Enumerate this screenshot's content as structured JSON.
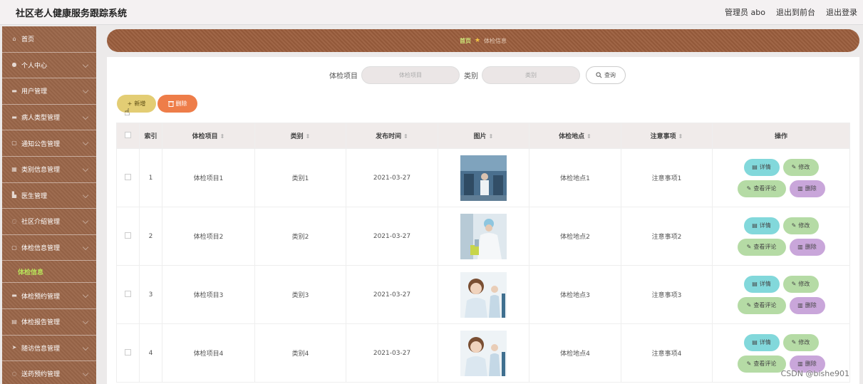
{
  "header": {
    "title": "社区老人健康服务跟踪系统",
    "admin": "管理员 abo",
    "to_front": "退出到前台",
    "logout": "退出登录"
  },
  "sidebar": {
    "items": [
      {
        "label": "首页",
        "icon": "home-icon"
      },
      {
        "label": "个人中心",
        "icon": "user-icon"
      },
      {
        "label": "用户管理",
        "icon": "users-icon"
      },
      {
        "label": "病人类型管理",
        "icon": "list-icon"
      },
      {
        "label": "通知公告管理",
        "icon": "notice-icon"
      },
      {
        "label": "类别信息管理",
        "icon": "category-icon"
      },
      {
        "label": "医生管理",
        "icon": "doctor-icon"
      },
      {
        "label": "社区介绍管理",
        "icon": "community-icon"
      },
      {
        "label": "体检信息管理",
        "icon": "exam-icon"
      }
    ],
    "active_sub": "体检信息",
    "items_after": [
      {
        "label": "体检预约管理",
        "icon": "appointment-icon"
      },
      {
        "label": "体检报告管理",
        "icon": "report-icon"
      },
      {
        "label": "随访信息管理",
        "icon": "followup-icon"
      },
      {
        "label": "送药预约管理",
        "icon": "medicine-icon"
      }
    ]
  },
  "breadcrumb": {
    "home": "首页",
    "current": "体检信息"
  },
  "search": {
    "field1_label": "体检项目",
    "field1_placeholder": "体检项目",
    "field2_label": "类别",
    "field2_placeholder": "类别",
    "button": "查询"
  },
  "toolbar": {
    "add": "新增",
    "delete": "删除"
  },
  "table": {
    "headers": [
      "索引",
      "体检项目",
      "类别",
      "发布时间",
      "图片",
      "体检地点",
      "注意事项",
      "操作"
    ],
    "rows": [
      {
        "index": "1",
        "item": "体检项目1",
        "category": "类别1",
        "date": "2021-03-27",
        "place": "体检地点1",
        "note": "注意事项1"
      },
      {
        "index": "2",
        "item": "体检项目2",
        "category": "类别2",
        "date": "2021-03-27",
        "place": "体检地点2",
        "note": "注意事项2"
      },
      {
        "index": "3",
        "item": "体检项目3",
        "category": "类别3",
        "date": "2021-03-27",
        "place": "体检地点3",
        "note": "注意事项3"
      },
      {
        "index": "4",
        "item": "体检项目4",
        "category": "类别4",
        "date": "2021-03-27",
        "place": "体检地点4",
        "note": "注意事项4"
      }
    ],
    "ops": {
      "detail": "详情",
      "edit": "修改",
      "review": "查看评论",
      "remove": "删除"
    }
  },
  "watermark": "CSDN @bishe901",
  "colors": {
    "sidebar": "#9a6649",
    "active_sub": "#b9e25a",
    "add_button": "#e3cd74",
    "delete_button": "#ee7d49"
  }
}
